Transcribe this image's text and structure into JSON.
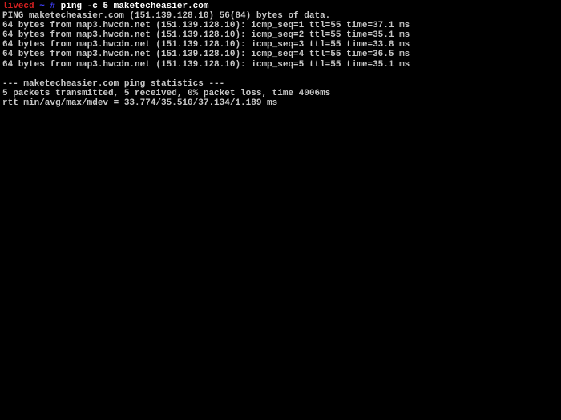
{
  "prompt": {
    "host": "livecd",
    "tilde": " ~ ",
    "hash": "# ",
    "command": "ping -c 5 maketecheasier.com"
  },
  "ping_header": "PING maketecheasier.com (151.139.128.10) 56(84) bytes of data.",
  "replies": [
    "64 bytes from map3.hwcdn.net (151.139.128.10): icmp_seq=1 ttl=55 time=37.1 ms",
    "64 bytes from map3.hwcdn.net (151.139.128.10): icmp_seq=2 ttl=55 time=35.1 ms",
    "64 bytes from map3.hwcdn.net (151.139.128.10): icmp_seq=3 ttl=55 time=33.8 ms",
    "64 bytes from map3.hwcdn.net (151.139.128.10): icmp_seq=4 ttl=55 time=36.5 ms",
    "64 bytes from map3.hwcdn.net (151.139.128.10): icmp_seq=5 ttl=55 time=35.1 ms"
  ],
  "blank": " ",
  "stats_header": "--- maketecheasier.com ping statistics ---",
  "stats_summary": "5 packets transmitted, 5 received, 0% packet loss, time 4006ms",
  "stats_rtt": "rtt min/avg/max/mdev = 33.774/35.510/37.134/1.189 ms"
}
